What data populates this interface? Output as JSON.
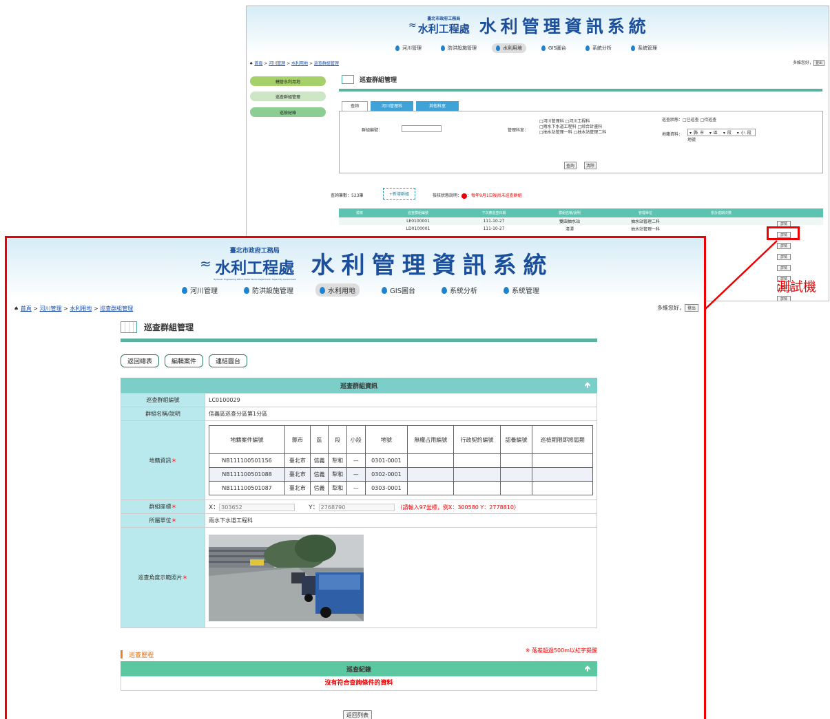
{
  "app": {
    "org_line1": "臺北市政府工務局",
    "org_line2": "水利工程處",
    "org_en": "Hydraulic Engineering Office, Public Works Department, Taipei City Government",
    "title": "水利管理資訊系統"
  },
  "nav": [
    "河川管理",
    "防洪設施管理",
    "水利用地",
    "GIS圖台",
    "系統分析",
    "系統管理"
  ],
  "breadcrumb": [
    "首頁",
    "河川管理",
    "水利用地",
    "巡查群組管理"
  ],
  "user": {
    "greeting": "多維您好，",
    "logout": "登出"
  },
  "bg": {
    "side": [
      "轄管水利用地",
      "巡查群組管理",
      "巡檢紀錄"
    ],
    "page_title": "巡查群組管理",
    "tabs": [
      "查詢",
      "河川管理科",
      "其他科室"
    ],
    "form": {
      "group_no_label": "群組編號：",
      "dept_label": "管理科室：",
      "depts": [
        "□河川管理科 □河川工程科",
        "□雨水下水道工程科 □綜合計畫科",
        "□抽水站管理一科 □抽水站管理二科"
      ],
      "status_label": "巡查狀態：□已巡查 □待巡查",
      "land_label": "地籍資料：",
      "land_selects": "▾縣市 ▾區 ▾段 ▾小段",
      "land_no": "地號",
      "search_btn": "查詢",
      "clear_btn": "清除"
    },
    "count": "查詢筆數：523筆",
    "add_btn": "+新增群組",
    "legend": "檢核狀態說明：",
    "legend_note": "：每年9月1日後尚未巡查群組",
    "headers": [
      "檢核",
      "巡查群組編號",
      "下次應巡查日期",
      "群組名稱/說明",
      "管理單位",
      "累計逾期次數"
    ],
    "rows": [
      [
        "LE0100001",
        "111-10-27",
        "雙園抽水站",
        "抽水站管理二科"
      ],
      [
        "LD0100001",
        "111-10-27",
        "清潭",
        "抽水站管理一科"
      ]
    ],
    "detail_btn": "詳情"
  },
  "annotation": "測試機",
  "fg": {
    "page_title": "巡查群組管理",
    "buttons": [
      "返回總表",
      "編輯案件",
      "連結圖台"
    ],
    "info_title": "巡查群組資訊",
    "labels": {
      "group_no": "巡查群組編號",
      "group_name": "群組名稱/說明",
      "land": "地籍資訊",
      "coord": "群組座標",
      "unit": "所屬單位",
      "photo": "巡查角度示範照片"
    },
    "group_no": "LC0100029",
    "group_name": "信義區巡查分區第1分區",
    "land_headers": [
      "地籍案件編號",
      "縣市",
      "區",
      "段",
      "小段",
      "地號",
      "無權占用編號",
      "行政契約編號",
      "認養編號",
      "巡檢期限即將屆期"
    ],
    "land_rows": [
      [
        "NB111100501156",
        "臺北市",
        "信義",
        "犁和",
        "—",
        "0301-0001",
        "",
        "",
        "",
        ""
      ],
      [
        "NB111100501088",
        "臺北市",
        "信義",
        "犁和",
        "—",
        "0302-0001",
        "",
        "",
        "",
        ""
      ],
      [
        "NB111100501087",
        "臺北市",
        "信義",
        "犁和",
        "—",
        "0303-0001",
        "",
        "",
        "",
        ""
      ]
    ],
    "coord": {
      "x_label": "X：",
      "x": "303652",
      "y_label": "Y：",
      "y": "2768790",
      "hint": "（請輸入97坐標，例X：300580 Y：2778810）"
    },
    "unit": "雨水下水道工程科",
    "history_title": "巡查歷程",
    "history_note": "※ 落差超過500m以紅字提醒",
    "record_title": "巡查紀錄",
    "no_data": "沒有符合查詢條件的資料",
    "back_btn": "返回列表"
  }
}
